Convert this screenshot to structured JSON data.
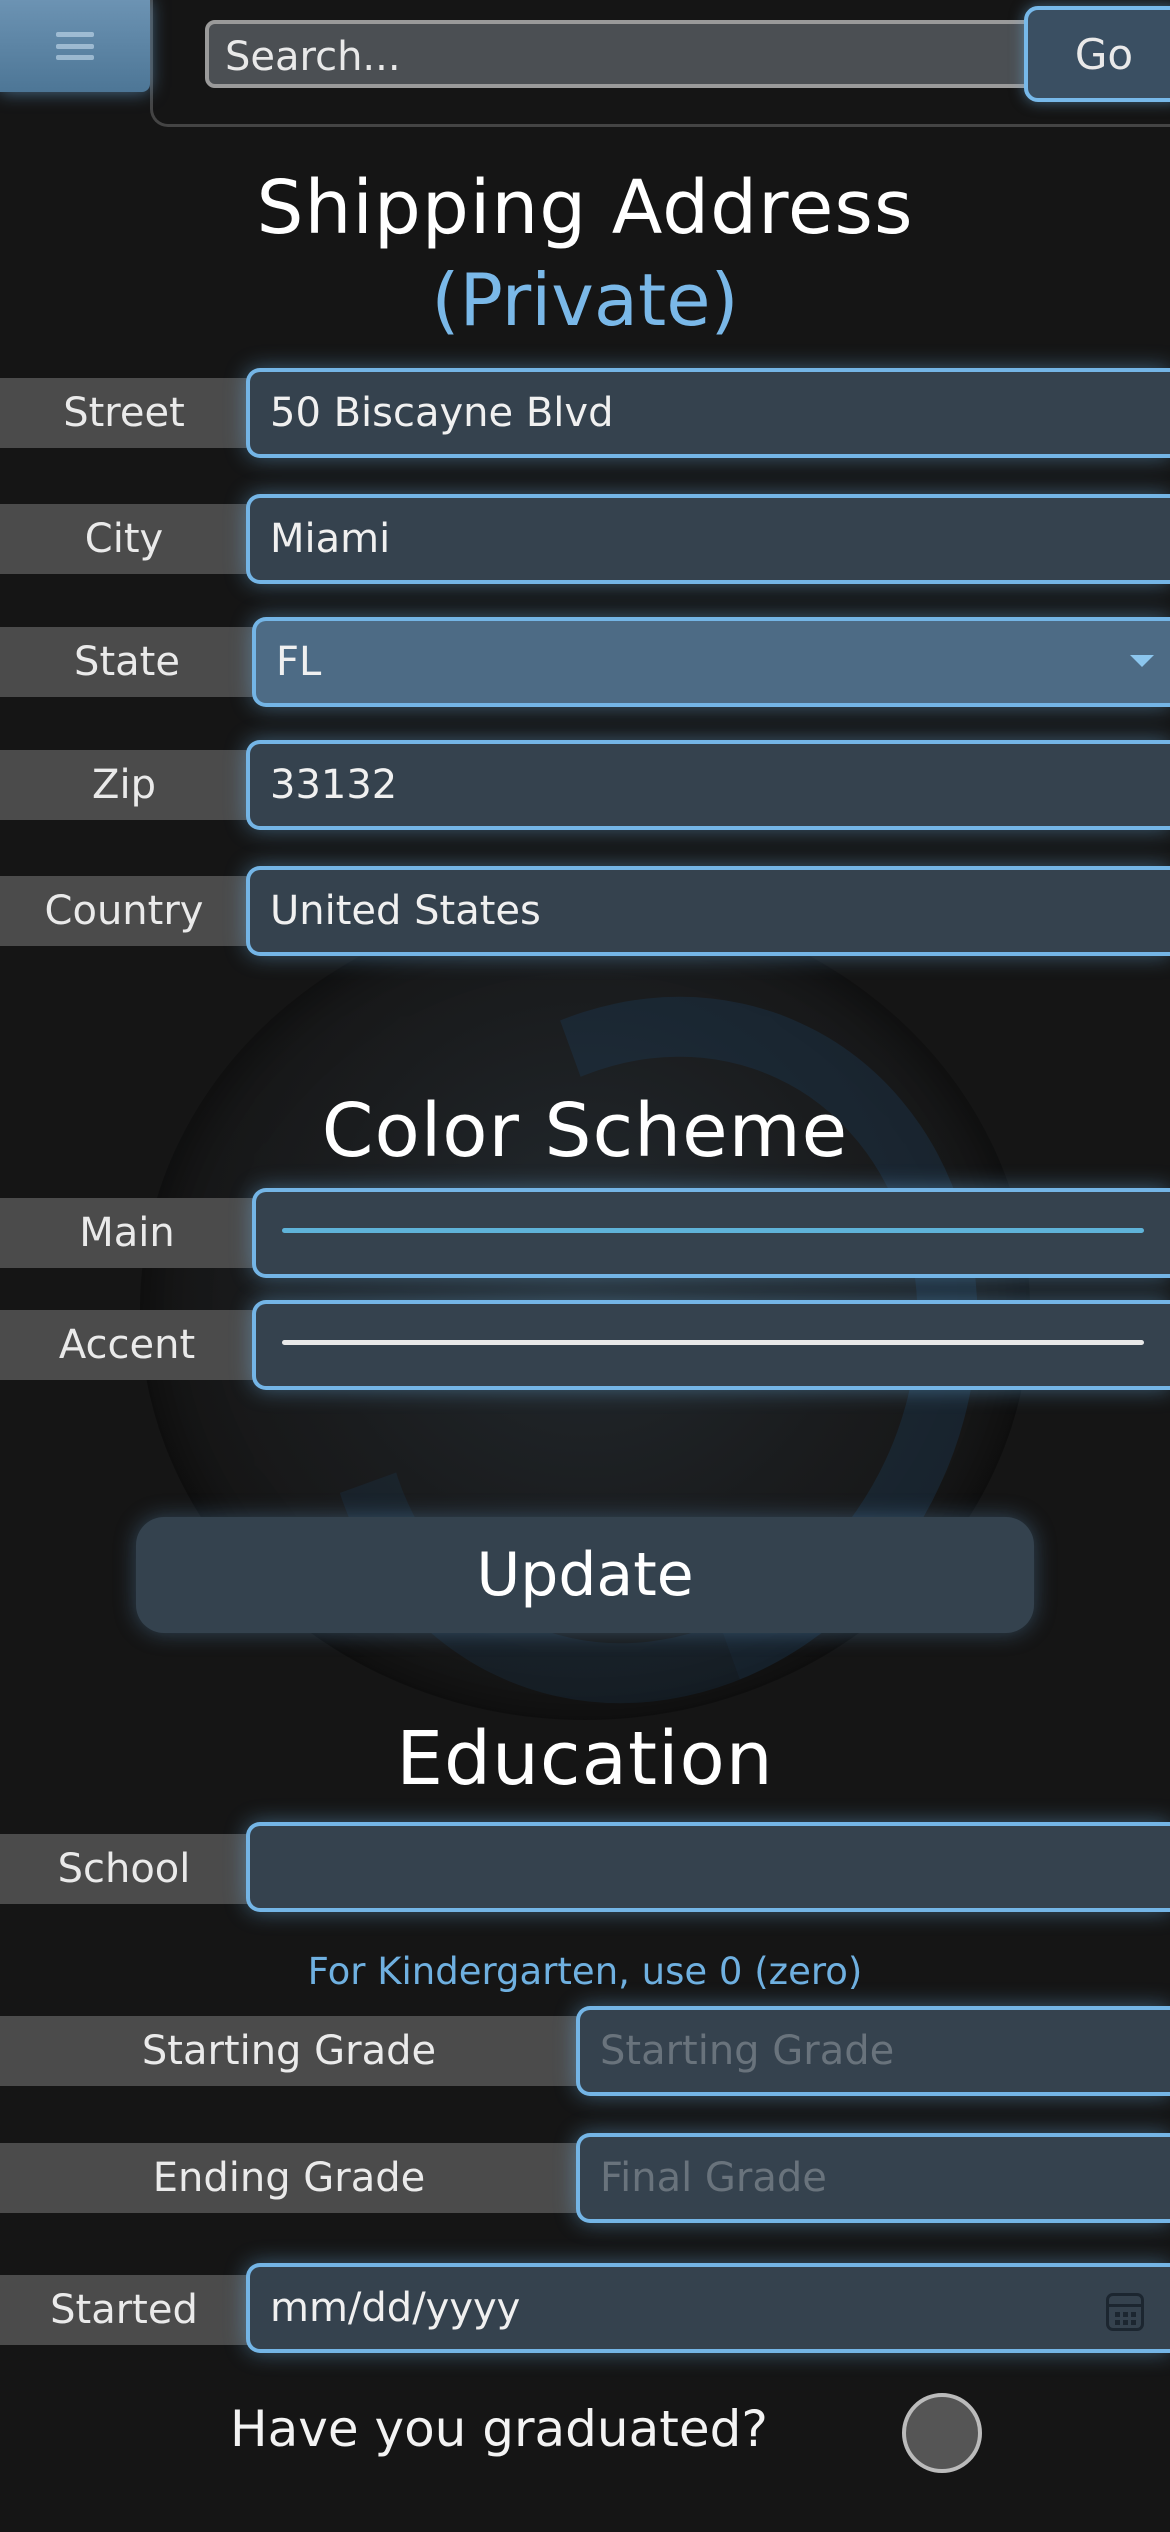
{
  "topbar": {
    "search_placeholder": "Search...",
    "go_label": "Go"
  },
  "shipping": {
    "title": "Shipping Address",
    "subtitle": "(Private)",
    "street_label": "Street",
    "street_value": "50 Biscayne Blvd",
    "city_label": "City",
    "city_value": "Miami",
    "state_label": "State",
    "state_value": "FL",
    "zip_label": "Zip",
    "zip_value": "33132",
    "country_label": "Country",
    "country_value": "United States"
  },
  "color_scheme": {
    "title": "Color Scheme",
    "main_label": "Main",
    "main_color": "#5fb3d9",
    "accent_label": "Accent",
    "accent_color": "#e8e8e8"
  },
  "update_label": "Update",
  "education": {
    "title": "Education",
    "school_label": "School",
    "school_value": "",
    "hint": "For Kindergarten, use 0 (zero)",
    "starting_grade_label": "Starting Grade",
    "starting_grade_placeholder": "Starting Grade",
    "ending_grade_label": "Ending Grade",
    "ending_grade_placeholder": "Final Grade",
    "started_label": "Started",
    "started_placeholder": "mm/dd/yyyy",
    "graduated_question": "Have you graduated?"
  },
  "icons": [
    "hamburger-menu-icon",
    "calendar-icon",
    "chevron-down-icon"
  ]
}
